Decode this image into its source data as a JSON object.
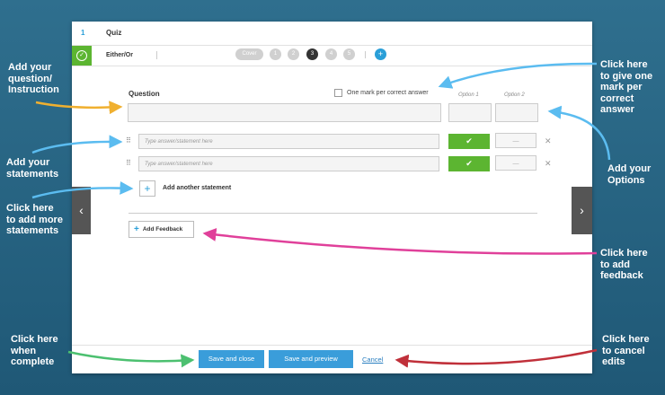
{
  "topbar": {
    "number": "1",
    "title": "Quiz"
  },
  "subbar": {
    "check_icon": "check-circle-icon",
    "type": "Either/Or",
    "steps": [
      {
        "label": "Cover"
      },
      {
        "label": "1"
      },
      {
        "label": "2"
      },
      {
        "label": "3",
        "active": true
      },
      {
        "label": "4"
      },
      {
        "label": "5"
      }
    ],
    "add_label": "+"
  },
  "question": {
    "label": "Question",
    "one_mark_label": "One mark per correct answer",
    "option1_label": "Option 1",
    "option2_label": "Option 2"
  },
  "statements": [
    {
      "placeholder": "Type answer/statement here",
      "option1": "✔",
      "option2": "—"
    },
    {
      "placeholder": "Type answer/statement here",
      "option1": "✔",
      "option2": "—"
    }
  ],
  "add_statement_label": "Add another statement",
  "add_feedback_label": "Add Feedback",
  "footer": {
    "save_close": "Save and close",
    "save_preview": "Save and preview",
    "cancel": "Cancel"
  },
  "annotations": {
    "question": "Add your\nquestion/\nInstruction",
    "statements": "Add your\nstatements",
    "more_statements": "Click here\nto add more\nstatements",
    "complete": "Click here\nwhen\ncomplete",
    "one_mark": "Click here\nto give one\nmark per\ncorrect\nanswer",
    "options": "Add your\nOptions",
    "feedback": "Click here\nto add\nfeedback",
    "cancel": "Click here\nto cancel\nedits"
  },
  "colors": {
    "background": "#2a6888",
    "accent_blue": "#3a9dda",
    "green": "#5cb531",
    "arrow_orange": "#f0b030",
    "arrow_blue": "#5bbcf0",
    "arrow_pink": "#e0409a",
    "arrow_green": "#4cc070",
    "arrow_red": "#c0303a"
  }
}
